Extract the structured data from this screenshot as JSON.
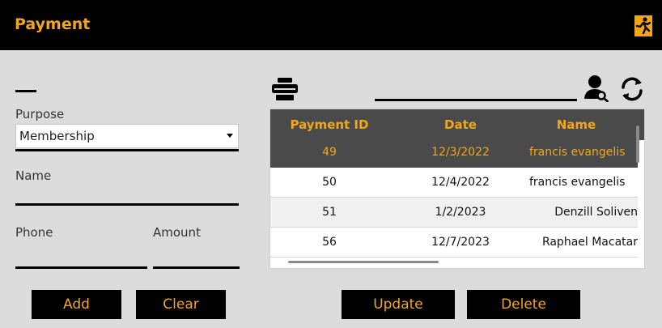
{
  "header": {
    "title": "Payment",
    "accent": "#f2a71b"
  },
  "form": {
    "purpose_label": "Purpose",
    "purpose_value": "Membership",
    "name_label": "Name",
    "name_value": "",
    "phone_label": "Phone",
    "phone_value": "",
    "amount_label": "Amount",
    "amount_value": ""
  },
  "buttons": {
    "add": "Add",
    "clear": "Clear",
    "update": "Update",
    "delete": "Delete"
  },
  "toolbar": {
    "print_icon": "printer-icon",
    "search_icon": "user-search-icon",
    "refresh_icon": "refresh-icon",
    "search_value": ""
  },
  "table": {
    "columns": [
      "Payment ID",
      "Date",
      "Name"
    ],
    "rows": [
      {
        "id": "49",
        "date": "12/3/2022",
        "name": "francis evangelis",
        "selected": true
      },
      {
        "id": "50",
        "date": "12/4/2022",
        "name": "francis evangelis",
        "selected": false
      },
      {
        "id": "51",
        "date": "1/2/2023",
        "name": "Denzill Soliven",
        "selected": false
      },
      {
        "id": "56",
        "date": "12/7/2023",
        "name": "Raphael Macatar",
        "selected": false
      }
    ]
  }
}
